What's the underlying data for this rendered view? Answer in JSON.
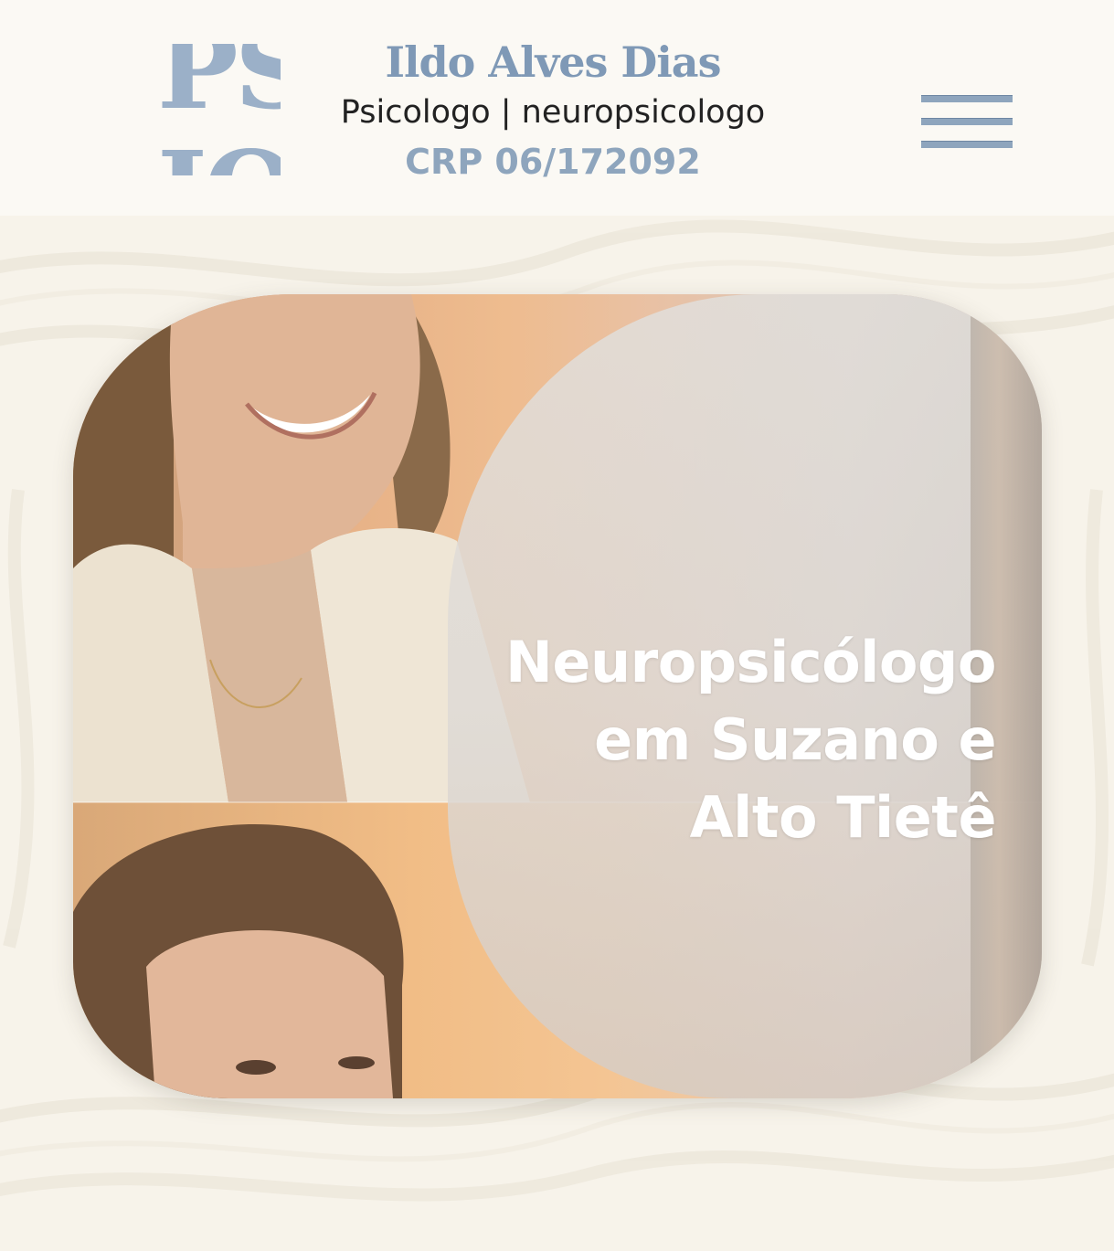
{
  "header": {
    "logo_text": [
      "PSI",
      "IOLOGO"
    ],
    "name": "Ildo Alves Dias",
    "subtitle": "Psicologo | neuropsicologo",
    "crp": "CRP 06/172092",
    "menu_icon": "hamburger-menu-icon"
  },
  "hero": {
    "title_lines": [
      "Neuropsicólogo",
      "em Suzano e",
      "Alto Tietê"
    ]
  },
  "colors": {
    "brand_blue": "#8ea5bd",
    "brand_blue_dark": "#7f99b6",
    "background": "#fbf9f4",
    "text_dark": "#222222",
    "hero_text": "#ffffff"
  }
}
